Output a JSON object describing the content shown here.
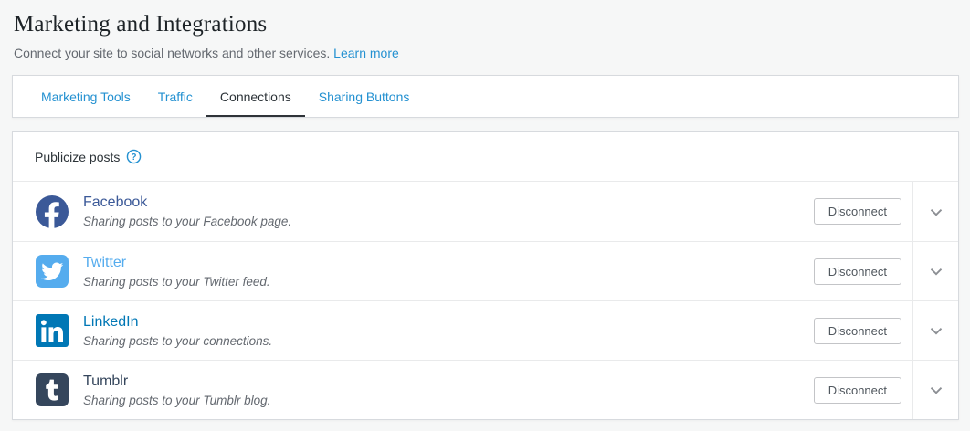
{
  "page": {
    "title": "Marketing and Integrations",
    "description": "Connect your site to social networks and other services.",
    "learn_more_label": "Learn more"
  },
  "tabs": [
    {
      "label": "Marketing Tools",
      "active": false
    },
    {
      "label": "Traffic",
      "active": false
    },
    {
      "label": "Connections",
      "active": true
    },
    {
      "label": "Sharing Buttons",
      "active": false
    }
  ],
  "connections": {
    "section_title": "Publicize posts",
    "help_icon": "question-mark-circle-icon",
    "services": [
      {
        "name": "Facebook",
        "description": "Sharing posts to your Facebook page.",
        "action_label": "Disconnect",
        "brand_color": "#3b5998",
        "name_color": "#3b5998",
        "icon": "facebook-icon",
        "expand_icon": "chevron-down-icon"
      },
      {
        "name": "Twitter",
        "description": "Sharing posts to your Twitter feed.",
        "action_label": "Disconnect",
        "brand_color": "#55acee",
        "name_color": "#55acee",
        "icon": "twitter-icon",
        "expand_icon": "chevron-down-icon"
      },
      {
        "name": "LinkedIn",
        "description": "Sharing posts to your connections.",
        "action_label": "Disconnect",
        "brand_color": "#0077b5",
        "name_color": "#0077b5",
        "icon": "linkedin-icon",
        "expand_icon": "chevron-down-icon"
      },
      {
        "name": "Tumblr",
        "description": "Sharing posts to your Tumblr blog.",
        "action_label": "Disconnect",
        "brand_color": "#35465c",
        "name_color": "#35465c",
        "icon": "tumblr-icon",
        "expand_icon": "chevron-down-icon"
      }
    ]
  },
  "colors": {
    "link_blue": "#2491d1",
    "page_background": "#f6f7f7",
    "active_tab_text": "#2c3338",
    "muted_text": "#646970",
    "chevron_gray": "#8c8f94"
  }
}
